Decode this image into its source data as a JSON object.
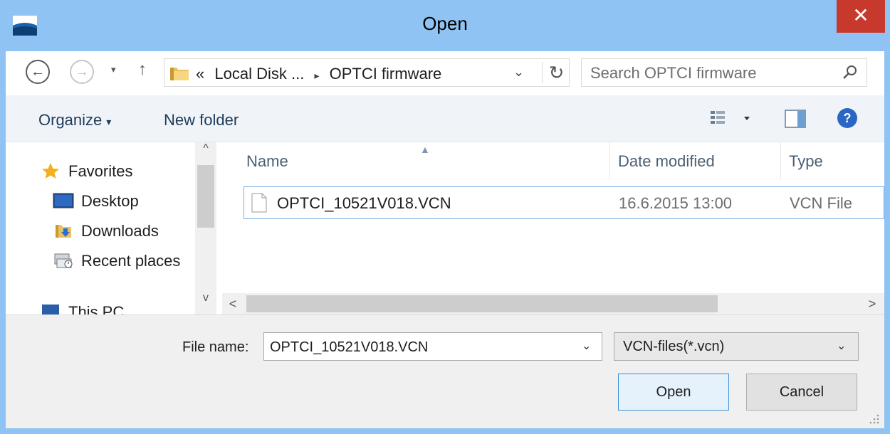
{
  "window": {
    "title": "Open",
    "close_label": "✕"
  },
  "nav": {
    "back_label": "←",
    "forward_label": "→",
    "recent_label": "▾",
    "up_label": "↑",
    "address": {
      "prefix": "«",
      "crumb1": "Local Disk ...",
      "sep": "▸",
      "crumb2": "OPTCI firmware",
      "drop": "⌄",
      "refresh": "↻"
    },
    "search": {
      "placeholder": "Search OPTCI firmware"
    }
  },
  "toolbar": {
    "organize_label": "Organize",
    "organize_caret": "▾",
    "new_folder_label": "New folder",
    "help_label": "?"
  },
  "sidebar": {
    "scroll_up": "^",
    "scroll_down": "v",
    "items": [
      {
        "label": "Favorites",
        "icon": "star-icon"
      },
      {
        "label": "Desktop",
        "icon": "desktop-icon"
      },
      {
        "label": "Downloads",
        "icon": "downloads-icon"
      },
      {
        "label": "Recent places",
        "icon": "recent-places-icon"
      },
      {
        "label": "This PC",
        "icon": "this-pc-icon"
      }
    ]
  },
  "files": {
    "sort_indicator": "▲",
    "columns": [
      "Name",
      "Date modified",
      "Type"
    ],
    "rows": [
      {
        "name": "OPTCI_10521V018.VCN",
        "date": "16.6.2015 13:00",
        "type": "VCN File"
      }
    ],
    "scroll_left": "<",
    "scroll_right": ">"
  },
  "footer": {
    "filename_label": "File name:",
    "filename_value": "OPTCI_10521V018.VCN",
    "filename_drop": "⌄",
    "filetype_value": "VCN-files(*.vcn)",
    "filetype_drop": "⌄",
    "open_label": "Open",
    "cancel_label": "Cancel"
  },
  "colors": {
    "titlebar": "#8ec3f3",
    "close": "#c7392d",
    "selection_border": "#78b2e6",
    "open_button_border": "#3c8fd9"
  }
}
